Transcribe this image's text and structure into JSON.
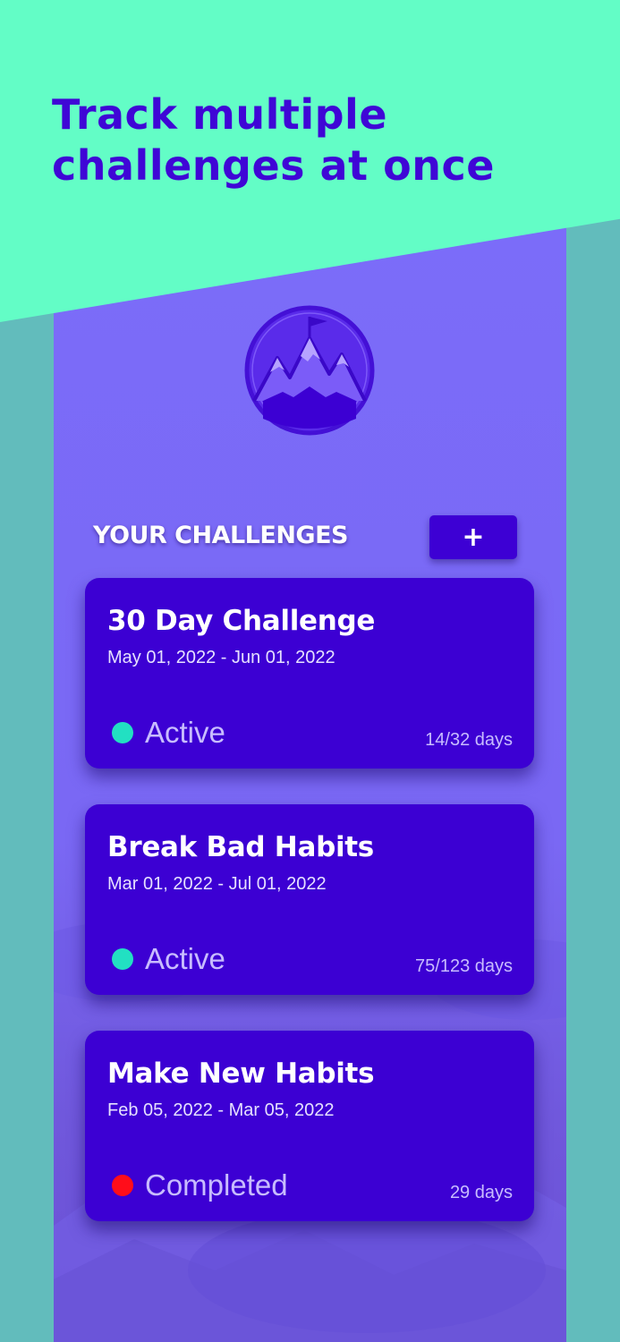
{
  "headline": {
    "line1": "Track multiple",
    "line2": "challenges at once"
  },
  "logo": {
    "icon": "mountain-flag-icon"
  },
  "section": {
    "title": "YOUR CHALLENGES",
    "add_label": "+"
  },
  "colors": {
    "banner": "#63fdc6",
    "headline": "#3f06d6",
    "card": "#3c00d3",
    "active": "#22e0c2",
    "completed": "#ff0d1a",
    "background": "#62bcbc"
  },
  "challenges": [
    {
      "title": "30 Day Challenge",
      "dates": "May 01, 2022 - Jun 01, 2022",
      "status": "Active",
      "days": "14/32 days"
    },
    {
      "title": "Break Bad Habits",
      "dates": "Mar 01, 2022 - Jul 01, 2022",
      "status": "Active",
      "days": "75/123 days"
    },
    {
      "title": "Make New Habits",
      "dates": "Feb 05, 2022 - Mar 05, 2022",
      "status": "Completed",
      "days": "29 days"
    }
  ]
}
